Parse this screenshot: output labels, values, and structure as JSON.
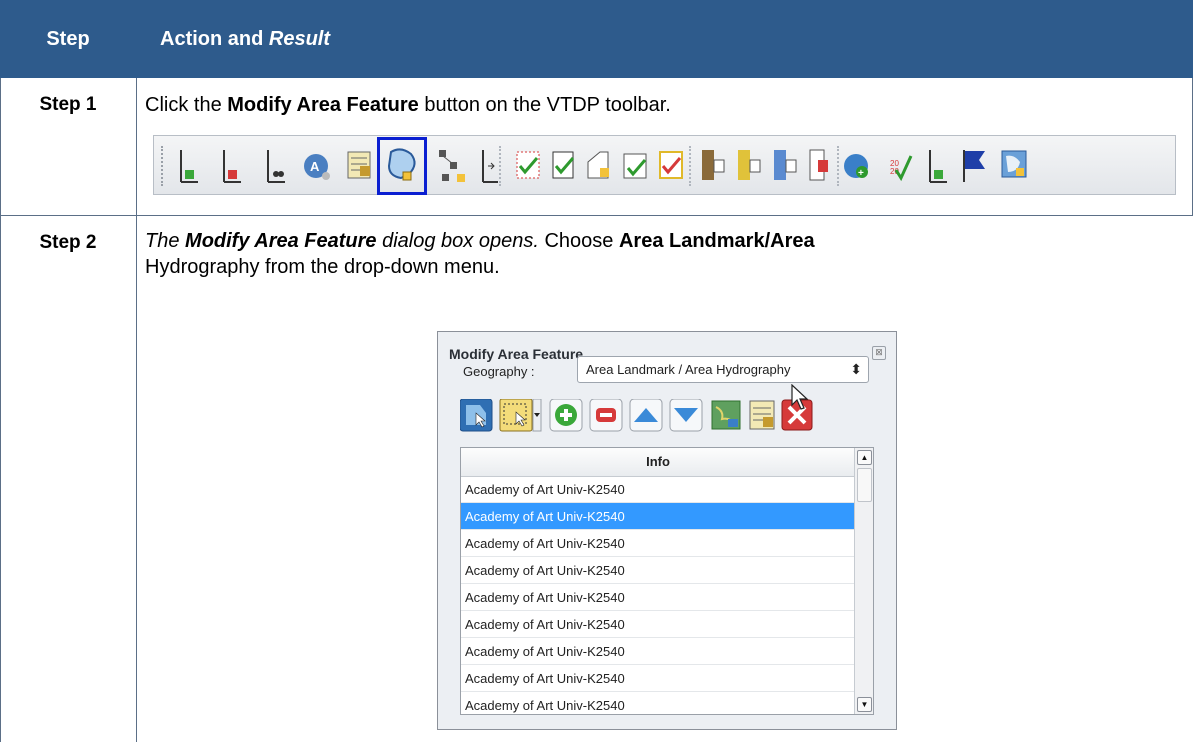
{
  "table": {
    "header": {
      "step": "Step",
      "action_prefix": "Action and ",
      "action_italic": "Result"
    },
    "rows": [
      {
        "step": "Step 1",
        "text_pre": "Click the ",
        "text_bold": "Modify Area Feature",
        "text_post": " button on the VTDP toolbar."
      },
      {
        "step": "Step 2",
        "text_italic_pre": "The ",
        "text_italic_bold": "Modify Area Feature",
        "text_italic_post": " dialog box opens.",
        "text_mid": " Choose ",
        "text_bold": "Area Landmark/Area",
        "text_line2": "Hydrography from the drop-down menu."
      }
    ]
  },
  "toolbar": {
    "highlighted_button": "modify-area-feature",
    "highlight_color": "#0a1fd1",
    "buttons": [
      "add-line-icon",
      "delete-line-icon",
      "split-line-icon",
      "area-query-icon",
      "attribute-table-icon",
      "modify-area-feature-icon",
      "topology-icon",
      "flip-line-icon",
      "review-check-icon",
      "review-check-line-icon",
      "review-area-icon",
      "review-check-area-icon",
      "review-check-yellow-icon",
      "export-icon",
      "export-yellow-icon",
      "export-blue-icon",
      "export-red-icon",
      "add-globe-icon",
      "2020-check-icon",
      "add-point-icon",
      "flag-icon",
      "map-icon"
    ]
  },
  "dialog": {
    "title": "Modify Area Feature",
    "geography_label": "Geography :",
    "geography_value": "Area Landmark / Area Hydrography",
    "list_header": "Info",
    "items": [
      "Academy of Art Univ-K2540",
      "Academy of Art Univ-K2540",
      "Academy of Art Univ-K2540",
      "Academy of Art Univ-K2540",
      "Academy of Art Univ-K2540",
      "Academy of Art Univ-K2540",
      "Academy of Art Univ-K2540",
      "Academy of Art Univ-K2540",
      "Academy of Art Univ-K2540"
    ],
    "selected_index": 1,
    "selection_color": "#3399ff"
  },
  "colors": {
    "header_bg": "#2e5b8c"
  }
}
